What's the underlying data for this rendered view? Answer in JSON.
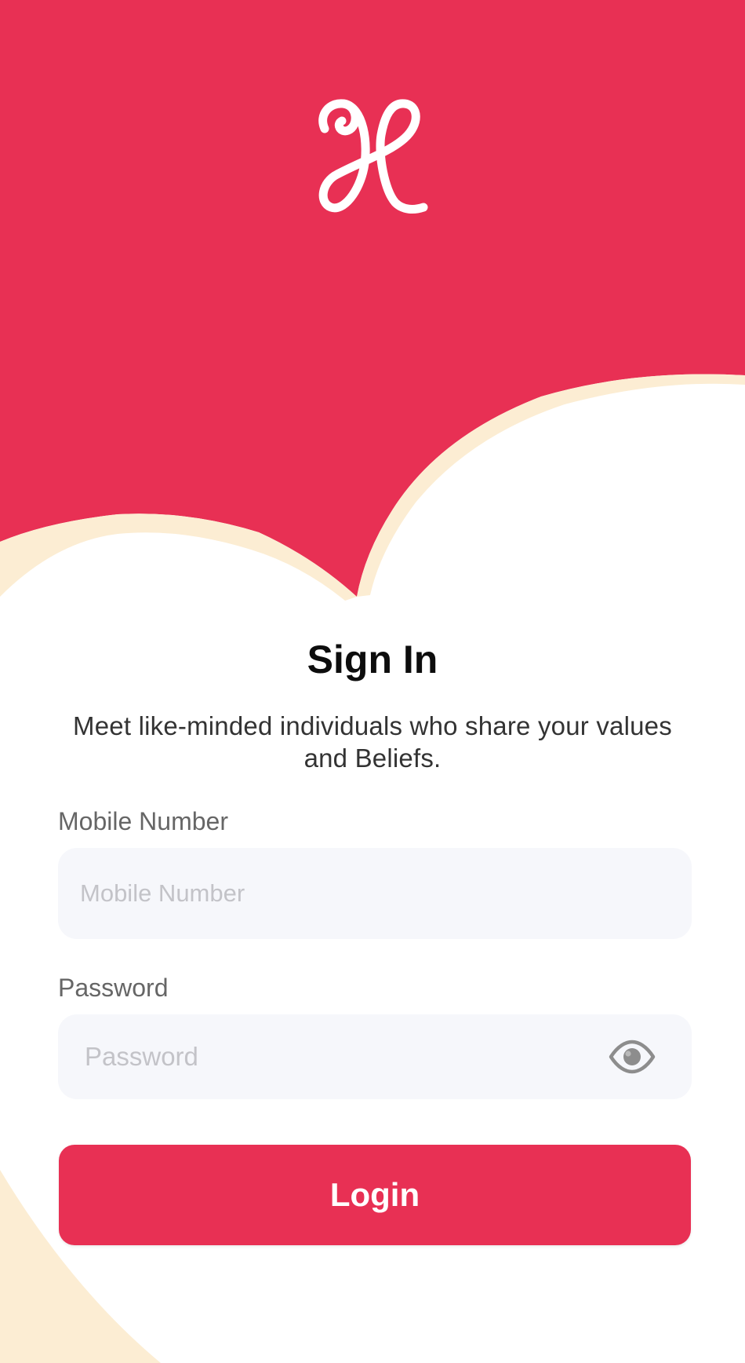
{
  "colors": {
    "brand": "#e83054",
    "cream": "#fcedd3",
    "input_bg": "#f6f7fb",
    "label": "#666666",
    "placeholder": "#c3c3c8"
  },
  "header": {
    "logo_icon": "script-x-logo-icon"
  },
  "signin": {
    "title": "Sign In",
    "subtitle": "Meet like-minded individuals who share your values and Beliefs."
  },
  "form": {
    "mobile": {
      "label": "Mobile Number",
      "placeholder": "Mobile Number",
      "value": ""
    },
    "password": {
      "label": "Password",
      "placeholder": "Password",
      "value": "",
      "toggle_icon": "eye-icon"
    },
    "login_label": "Login"
  }
}
